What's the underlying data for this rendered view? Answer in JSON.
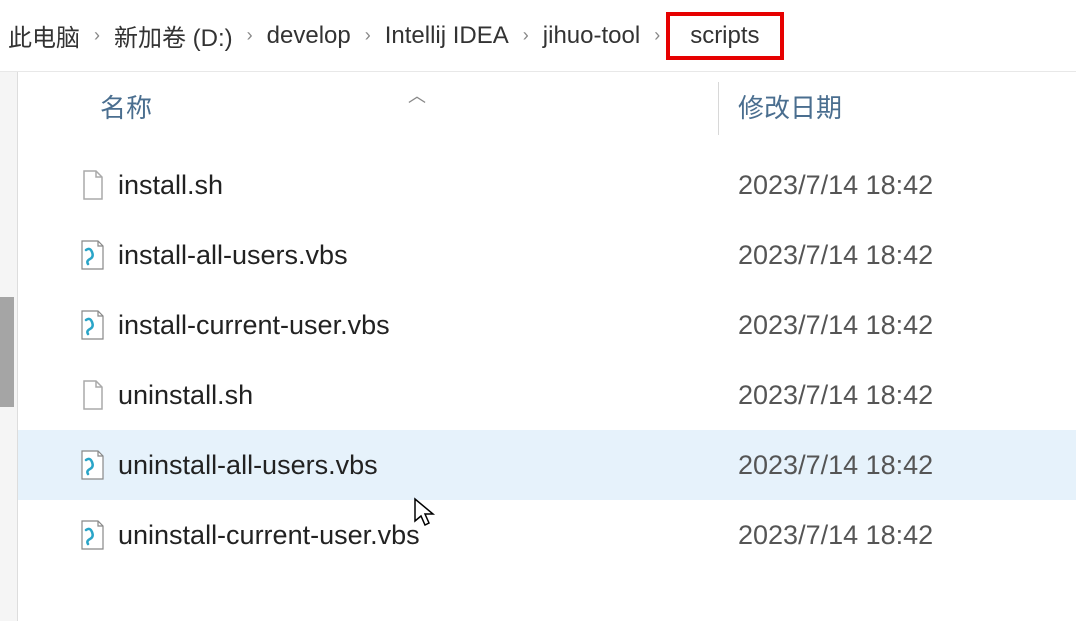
{
  "breadcrumb": {
    "items": [
      {
        "label": "此电脑"
      },
      {
        "label": "新加卷 (D:)"
      },
      {
        "label": "develop"
      },
      {
        "label": "Intellij IDEA"
      },
      {
        "label": "jihuo-tool"
      },
      {
        "label": "scripts",
        "highlighted": true
      }
    ]
  },
  "columns": {
    "name": "名称",
    "date": "修改日期"
  },
  "files": [
    {
      "name": "install.sh",
      "date": "2023/7/14 18:42",
      "icon": "doc"
    },
    {
      "name": "install-all-users.vbs",
      "date": "2023/7/14 18:42",
      "icon": "vbs"
    },
    {
      "name": "install-current-user.vbs",
      "date": "2023/7/14 18:42",
      "icon": "vbs"
    },
    {
      "name": "uninstall.sh",
      "date": "2023/7/14 18:42",
      "icon": "doc"
    },
    {
      "name": "uninstall-all-users.vbs",
      "date": "2023/7/14 18:42",
      "icon": "vbs",
      "selected": true
    },
    {
      "name": "uninstall-current-user.vbs",
      "date": "2023/7/14 18:42",
      "icon": "vbs"
    }
  ]
}
